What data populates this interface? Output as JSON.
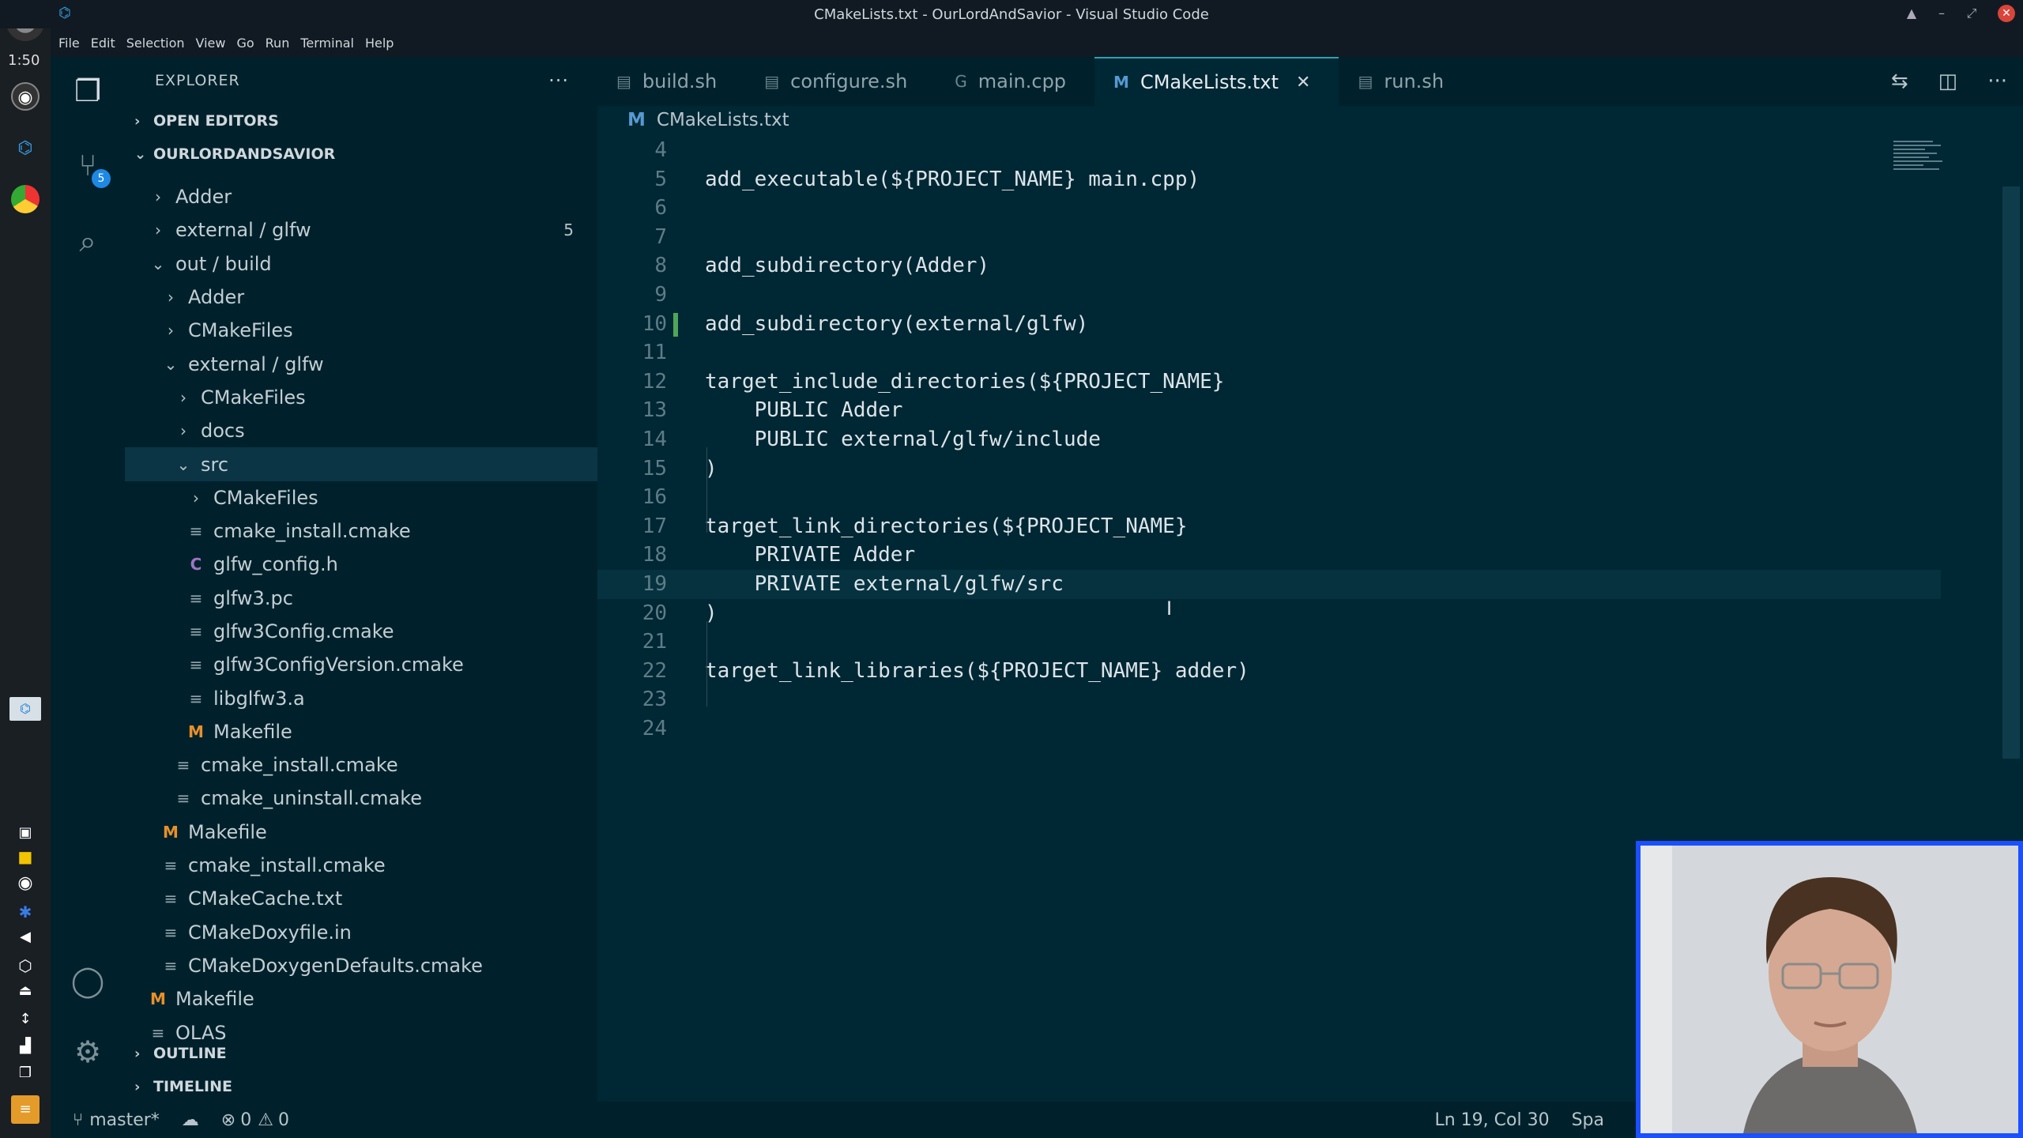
{
  "window": {
    "title": "CMakeLists.txt - OurLordAndSavior - Visual Studio Code"
  },
  "desktop": {
    "clock": "1:50"
  },
  "menu": [
    "File",
    "Edit",
    "Selection",
    "View",
    "Go",
    "Run",
    "Terminal",
    "Help"
  ],
  "activity": {
    "scm_badge": "5"
  },
  "sidebar": {
    "title": "EXPLORER",
    "more": "···",
    "open_editors": "OPEN EDITORS",
    "workspace": "OURLORDANDSAVIOR",
    "tree": [
      {
        "label": "Adder",
        "depth": 1,
        "kind": "folder-closed"
      },
      {
        "label": "external / glfw",
        "depth": 1,
        "kind": "folder-closed",
        "count": "5"
      },
      {
        "label": "out / build",
        "depth": 1,
        "kind": "folder-open"
      },
      {
        "label": "Adder",
        "depth": 2,
        "kind": "folder-closed"
      },
      {
        "label": "CMakeFiles",
        "depth": 2,
        "kind": "folder-closed"
      },
      {
        "label": "external / glfw",
        "depth": 2,
        "kind": "folder-open"
      },
      {
        "label": "CMakeFiles",
        "depth": 3,
        "kind": "folder-closed"
      },
      {
        "label": "docs",
        "depth": 3,
        "kind": "folder-closed"
      },
      {
        "label": "src",
        "depth": 3,
        "kind": "folder-open",
        "selected": true
      },
      {
        "label": "CMakeFiles",
        "depth": 4,
        "kind": "folder-closed"
      },
      {
        "label": "cmake_install.cmake",
        "depth": 4,
        "kind": "file"
      },
      {
        "label": "glfw_config.h",
        "depth": 4,
        "kind": "c"
      },
      {
        "label": "glfw3.pc",
        "depth": 4,
        "kind": "file"
      },
      {
        "label": "glfw3Config.cmake",
        "depth": 4,
        "kind": "file"
      },
      {
        "label": "glfw3ConfigVersion.cmake",
        "depth": 4,
        "kind": "file"
      },
      {
        "label": "libglfw3.a",
        "depth": 4,
        "kind": "file"
      },
      {
        "label": "Makefile",
        "depth": 4,
        "kind": "m"
      },
      {
        "label": "cmake_install.cmake",
        "depth": 3,
        "kind": "file"
      },
      {
        "label": "cmake_uninstall.cmake",
        "depth": 3,
        "kind": "file"
      },
      {
        "label": "Makefile",
        "depth": 2,
        "kind": "m"
      },
      {
        "label": "cmake_install.cmake",
        "depth": 2,
        "kind": "file"
      },
      {
        "label": "CMakeCache.txt",
        "depth": 2,
        "kind": "file"
      },
      {
        "label": "CMakeDoxyfile.in",
        "depth": 2,
        "kind": "file"
      },
      {
        "label": "CMakeDoxygenDefaults.cmake",
        "depth": 2,
        "kind": "file"
      },
      {
        "label": "Makefile",
        "depth": 1,
        "kind": "m"
      },
      {
        "label": "OLAS",
        "depth": 1,
        "kind": "file"
      }
    ],
    "outline": "OUTLINE",
    "timeline": "TIMELINE"
  },
  "tabs": [
    {
      "label": "build.sh",
      "icon": "file-icon"
    },
    {
      "label": "configure.sh",
      "icon": "file-icon"
    },
    {
      "label": "main.cpp",
      "icon": "cpp-icon"
    },
    {
      "label": "CMakeLists.txt",
      "icon": "modified-icon",
      "active": true,
      "prefix": "M"
    },
    {
      "label": "run.sh",
      "icon": "file-icon"
    }
  ],
  "breadcrumb": {
    "prefix": "M",
    "file": "CMakeLists.txt"
  },
  "code": [
    {
      "n": "4",
      "t": ""
    },
    {
      "n": "5",
      "t": "add_executable(${PROJECT_NAME} main.cpp)"
    },
    {
      "n": "6",
      "t": ""
    },
    {
      "n": "7",
      "t": ""
    },
    {
      "n": "8",
      "t": "add_subdirectory(Adder)"
    },
    {
      "n": "9",
      "t": ""
    },
    {
      "n": "10",
      "t": "add_subdirectory(external/glfw)",
      "gutter": true
    },
    {
      "n": "11",
      "t": ""
    },
    {
      "n": "12",
      "t": "target_include_directories(${PROJECT_NAME}"
    },
    {
      "n": "13",
      "t": "    PUBLIC Adder"
    },
    {
      "n": "14",
      "t": "    PUBLIC external/glfw/include"
    },
    {
      "n": "15",
      "t": ")"
    },
    {
      "n": "16",
      "t": ""
    },
    {
      "n": "17",
      "t": "target_link_directories(${PROJECT_NAME}"
    },
    {
      "n": "18",
      "t": "    PRIVATE Adder"
    },
    {
      "n": "19",
      "t": "    PRIVATE external/glfw/src",
      "current": true
    },
    {
      "n": "20",
      "t": ")"
    },
    {
      "n": "21",
      "t": ""
    },
    {
      "n": "22",
      "t": "target_link_libraries(${PROJECT_NAME} adder)"
    },
    {
      "n": "23",
      "t": ""
    },
    {
      "n": "24",
      "t": ""
    }
  ],
  "status": {
    "branch": "master*",
    "errors": "0",
    "warnings": "0",
    "position": "Ln 19, Col 30",
    "spaces": "Spa"
  },
  "colors": {
    "accent": "#1b4fff",
    "background": "#002734",
    "sidebar": "#00212b"
  }
}
